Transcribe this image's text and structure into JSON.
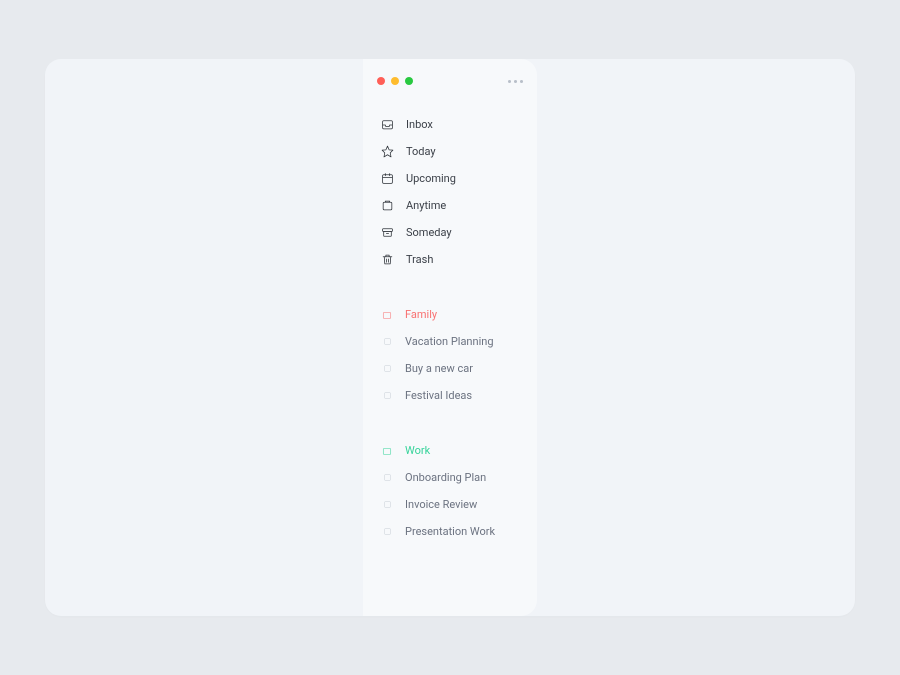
{
  "nav": {
    "items": [
      {
        "label": "Inbox",
        "icon": "inbox"
      },
      {
        "label": "Today",
        "icon": "star"
      },
      {
        "label": "Upcoming",
        "icon": "calendar"
      },
      {
        "label": "Anytime",
        "icon": "layers"
      },
      {
        "label": "Someday",
        "icon": "archive"
      },
      {
        "label": "Trash",
        "icon": "trash"
      }
    ]
  },
  "areas": [
    {
      "name": "Family",
      "color": "#f87171",
      "projects": [
        {
          "label": "Vacation Planning"
        },
        {
          "label": "Buy a new car"
        },
        {
          "label": "Festival Ideas"
        }
      ]
    },
    {
      "name": "Work",
      "color": "#34d399",
      "projects": [
        {
          "label": "Onboarding Plan"
        },
        {
          "label": "Invoice Review"
        },
        {
          "label": "Presentation Work"
        }
      ]
    }
  ]
}
